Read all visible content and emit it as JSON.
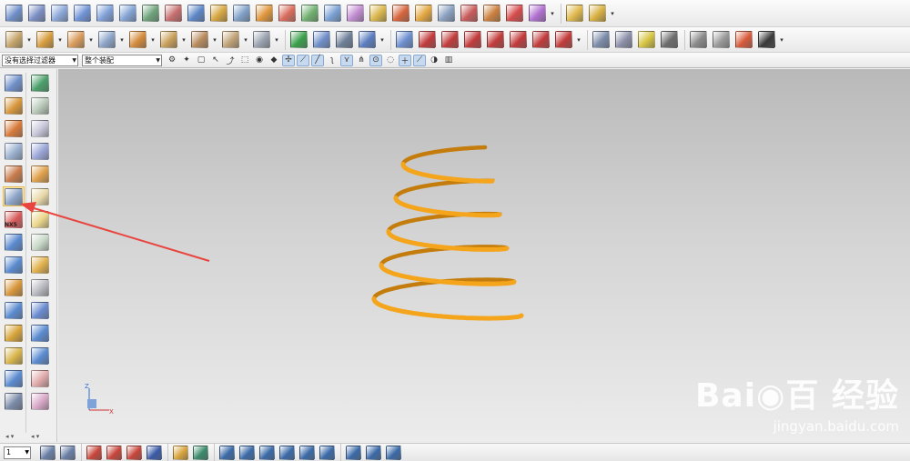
{
  "toolbar_row1": {
    "icons": [
      {
        "name": "surface-grid-icon",
        "color": "#6f8fc9"
      },
      {
        "name": "surface-mesh-icon",
        "color": "#7a8fc4"
      },
      {
        "name": "bounded-plane-icon",
        "color": "#8aa6d8"
      },
      {
        "name": "ruled-surface-icon",
        "color": "#6f93d6"
      },
      {
        "name": "through-curves-icon",
        "color": "#7fa0d8"
      },
      {
        "name": "curve-mesh-icon",
        "color": "#83a3d4"
      },
      {
        "name": "swept-icon",
        "color": "#6ea37a"
      },
      {
        "name": "section-surface-icon",
        "color": "#c76d6d"
      },
      {
        "name": "n-sided-surface-icon",
        "color": "#5c86c7"
      },
      {
        "name": "transition-icon",
        "color": "#d6a53f"
      },
      {
        "name": "bridge-surface-icon",
        "color": "#7fa0c8"
      },
      {
        "name": "face-blend-icon",
        "color": "#e0963b"
      },
      {
        "name": "styled-blend-icon",
        "color": "#d86b5c"
      },
      {
        "name": "offset-face-icon",
        "color": "#6fb06f"
      },
      {
        "name": "law-extension-icon",
        "color": "#7aa0d4"
      },
      {
        "name": "extension-surface-icon",
        "color": "#c08bd1"
      },
      {
        "name": "trim-body-icon",
        "color": "#d9b54a"
      },
      {
        "name": "sew-icon",
        "color": "#d6643c"
      },
      {
        "name": "studio-surface-icon",
        "color": "#e2a640"
      },
      {
        "name": "x-form-icon",
        "color": "#8aa0c0"
      },
      {
        "name": "silhouette-flange-icon",
        "color": "#c85a5a"
      },
      {
        "name": "flange-surface-icon",
        "color": "#cc7f3e"
      },
      {
        "name": "global-shaping-icon",
        "color": "#d64a4a"
      },
      {
        "name": "styled-sweep-icon",
        "color": "#b06fd0"
      }
    ],
    "group_icons": [
      {
        "name": "feature-box-icon",
        "color": "#e0b84a"
      },
      {
        "name": "assembly-box-icon",
        "color": "#d8b040"
      }
    ]
  },
  "toolbar_row2": {
    "icons": [
      {
        "name": "extrude-gear-icon",
        "color": "#c6a56b"
      },
      {
        "name": "revolve-icon",
        "color": "#d79c3c"
      },
      {
        "name": "hole-icon",
        "color": "#d99a5a"
      },
      {
        "name": "boss-icon",
        "color": "#8ca4c8"
      },
      {
        "name": "pocket-icon",
        "color": "#d48a3a"
      },
      {
        "name": "pad-icon",
        "color": "#c9a05a"
      },
      {
        "name": "slot-icon",
        "color": "#b88a5c"
      },
      {
        "name": "groove-icon",
        "color": "#c0a276"
      },
      {
        "name": "thread-icon",
        "color": "#9aa3b0"
      }
    ],
    "edit_icons": [
      {
        "name": "check-mark-icon",
        "color": "#3aa04a"
      },
      {
        "name": "feature-table-icon",
        "color": "#6f8fc9"
      },
      {
        "name": "spreadsheet-icon",
        "color": "#6e7f99"
      },
      {
        "name": "datum-csys-icon",
        "color": "#5b7dc0"
      }
    ],
    "curve_icons": [
      {
        "name": "point-set-icon",
        "color": "#6c8ed0"
      },
      {
        "name": "project-curve-icon",
        "color": "#c23a3a"
      },
      {
        "name": "intersect-curve-icon",
        "color": "#c23a3a"
      },
      {
        "name": "bridge-curve-icon",
        "color": "#c23a3a"
      },
      {
        "name": "fillet-curve-icon",
        "color": "#c23a3a"
      },
      {
        "name": "chamfer-curve-icon",
        "color": "#c23a3a"
      },
      {
        "name": "offset-curve-icon",
        "color": "#c23a3a"
      },
      {
        "name": "curve-on-surface-icon",
        "color": "#c23a3a"
      }
    ],
    "misc_icons": [
      {
        "name": "spring-cylinder-icon",
        "color": "#7a8aa8"
      },
      {
        "name": "pin-icon",
        "color": "#8b8fa8"
      },
      {
        "name": "washer-icon",
        "color": "#d6c440"
      },
      {
        "name": "wire-icon",
        "color": "#6c6c6c"
      },
      {
        "name": "sheet-metal-icon",
        "color": "#8a8a8a"
      },
      {
        "name": "bend-icon",
        "color": "#999999"
      },
      {
        "name": "layers-icon",
        "color": "#d85a3a"
      },
      {
        "name": "dimension-icon",
        "color": "#3a3a3a"
      }
    ]
  },
  "row3": {
    "filter_select": "没有选择过滤器",
    "scope_select": "整个装配"
  },
  "left_col1": [
    {
      "name": "sketch-icon",
      "color": "#6f8fc9"
    },
    {
      "name": "extrude-icon",
      "color": "#d8963a"
    },
    {
      "name": "revolve-part-icon",
      "color": "#d87a3a"
    },
    {
      "name": "sweep-along-icon",
      "color": "#9ab0d0"
    },
    {
      "name": "tube-body-icon",
      "color": "#c87a4a"
    },
    {
      "name": "tube-icon",
      "color": "#8ca4c8",
      "active": true
    },
    {
      "name": "nx5-feature-icon",
      "color": "#d85a5a",
      "tag": "NX5"
    },
    {
      "name": "block-icon",
      "color": "#5a8ad0"
    },
    {
      "name": "cylinder-icon",
      "color": "#5a8ad0"
    },
    {
      "name": "cone-icon",
      "color": "#d8963a"
    },
    {
      "name": "sphere-icon",
      "color": "#5a8ad0"
    },
    {
      "name": "chamfer-body-icon",
      "color": "#d8a43a"
    },
    {
      "name": "edge-blend-icon",
      "color": "#d8b44a"
    },
    {
      "name": "shell-icon",
      "color": "#5a8ad0"
    },
    {
      "name": "thicken-icon",
      "color": "#7a8aa8"
    }
  ],
  "left_col2": [
    {
      "name": "datum-plane-icon",
      "color": "#4aa06a"
    },
    {
      "name": "datum-axis-icon",
      "color": "#b8c8b8"
    },
    {
      "name": "trim-icon",
      "color": "#c5c5d8"
    },
    {
      "name": "pyramid-icon",
      "color": "#9aa6d8"
    },
    {
      "name": "box-icon",
      "color": "#e0a04a"
    },
    {
      "name": "sheet-icon",
      "color": "#e8d8a8"
    },
    {
      "name": "crescent-icon",
      "color": "#ead68a"
    },
    {
      "name": "block-texture-icon",
      "color": "#c8d8c8"
    },
    {
      "name": "split-body-icon",
      "color": "#e0b04a"
    },
    {
      "name": "thread-spring-icon",
      "color": "#b8b8c0"
    },
    {
      "name": "pattern-icon",
      "color": "#6a8ad0"
    },
    {
      "name": "mirror-icon",
      "color": "#5a8ad0"
    },
    {
      "name": "gear-arc-icon",
      "color": "#5a8ad0"
    },
    {
      "name": "wireframe-box-icon",
      "color": "#e0a8a8"
    },
    {
      "name": "draft-icon",
      "color": "#d8a8c8"
    }
  ],
  "viewport": {
    "spring_color": "#f4a51c",
    "triad_z": "Z",
    "triad_x": "X",
    "watermark_main": "Bai◉百 经验",
    "watermark_sub": "jingyan.baidu.com"
  },
  "status": {
    "layer_value": "1",
    "icons": [
      {
        "name": "view-layers-icon",
        "color": "#6a7fa6"
      },
      {
        "name": "workplane-icon",
        "color": "#6a7fa6"
      },
      {
        "name": "wcs-origin-icon",
        "color": "#c8453a"
      },
      {
        "name": "wcs-dynamics-icon",
        "color": "#c8453a"
      },
      {
        "name": "wcs-rotate-icon",
        "color": "#c8453a"
      },
      {
        "name": "wcs-save-icon",
        "color": "#3a5aa8"
      },
      {
        "name": "brush-icon",
        "color": "#d8a43a"
      },
      {
        "name": "measure-icon",
        "color": "#3a8a6a"
      },
      {
        "name": "snap-view-icon",
        "color": "#3a6aa8"
      },
      {
        "name": "fit-view-icon",
        "color": "#3a6aa8"
      },
      {
        "name": "pan-view-icon",
        "color": "#3a6aa8"
      },
      {
        "name": "rotate-view-icon",
        "color": "#3a6aa8"
      },
      {
        "name": "zoom-view-icon",
        "color": "#3a6aa8"
      },
      {
        "name": "section-view-icon",
        "color": "#3a6aa8"
      },
      {
        "name": "ruler-icon",
        "color": "#3a6aa8"
      },
      {
        "name": "dimension-line-icon",
        "color": "#3a6aa8"
      },
      {
        "name": "measure-line-icon",
        "color": "#3a6aa8"
      }
    ]
  },
  "annotation": {
    "arrow_color": "#e8453f"
  }
}
